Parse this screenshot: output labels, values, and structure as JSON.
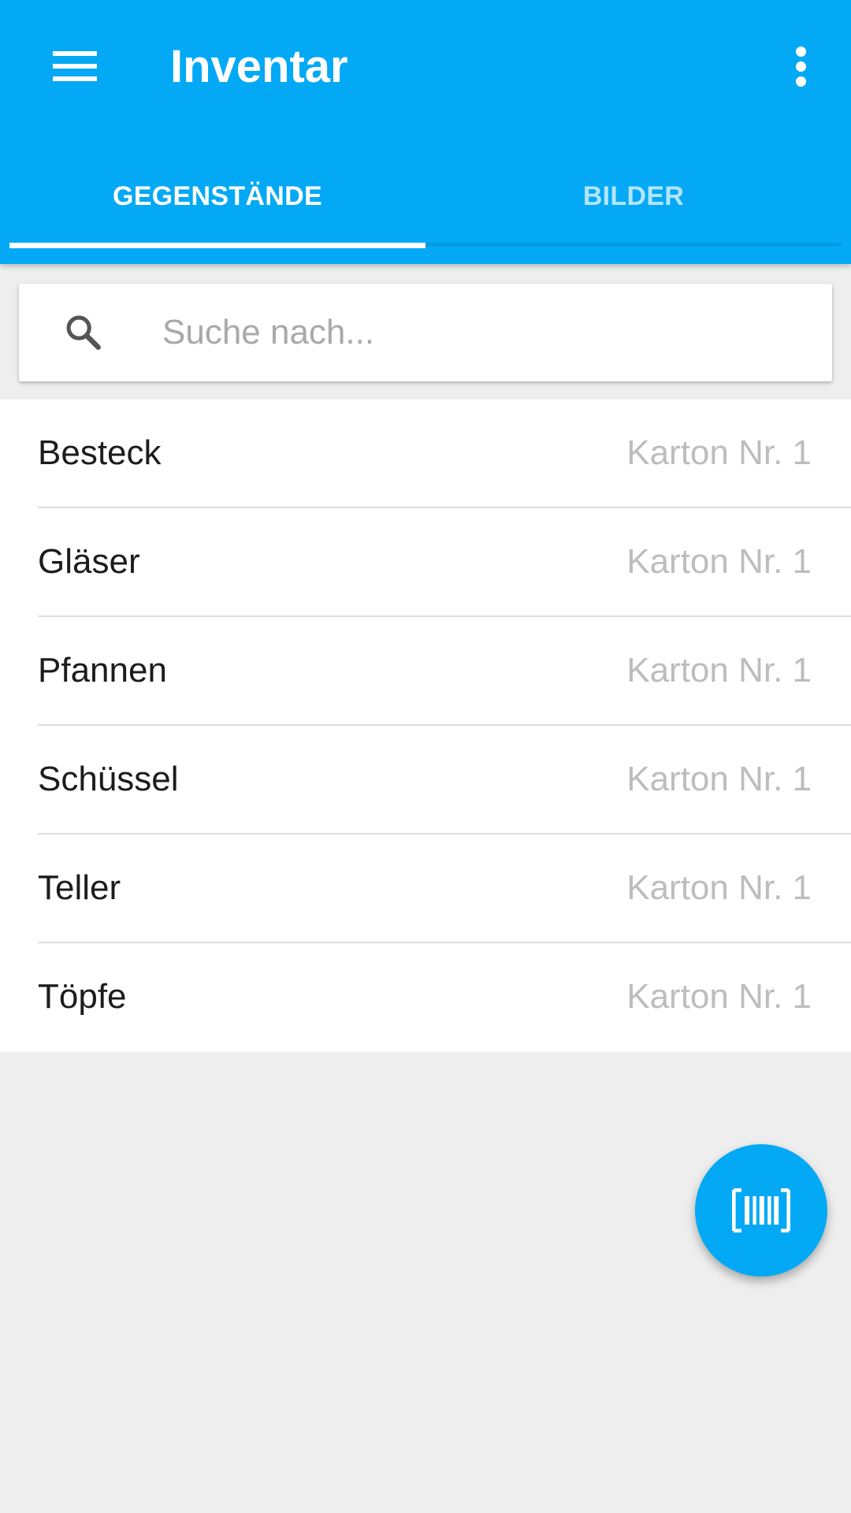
{
  "app": {
    "title": "Inventar",
    "accent_color": "#03a9f4"
  },
  "toolbar": {
    "menu_icon": "hamburger-menu-icon",
    "overflow_icon": "more-vert-icon"
  },
  "tabs": [
    {
      "label": "GEGENSTÄNDE",
      "active": true
    },
    {
      "label": "BILDER",
      "active": false
    }
  ],
  "search": {
    "icon": "search-icon",
    "placeholder": "Suche nach...",
    "value": ""
  },
  "items": [
    {
      "name": "Besteck",
      "location": "Karton Nr. 1"
    },
    {
      "name": "Gläser",
      "location": "Karton Nr. 1"
    },
    {
      "name": "Pfannen",
      "location": "Karton Nr. 1"
    },
    {
      "name": "Schüssel",
      "location": "Karton Nr. 1"
    },
    {
      "name": "Teller",
      "location": "Karton Nr. 1"
    },
    {
      "name": "Töpfe",
      "location": "Karton Nr. 1"
    }
  ],
  "fab": {
    "icon": "barcode-scan-icon"
  }
}
